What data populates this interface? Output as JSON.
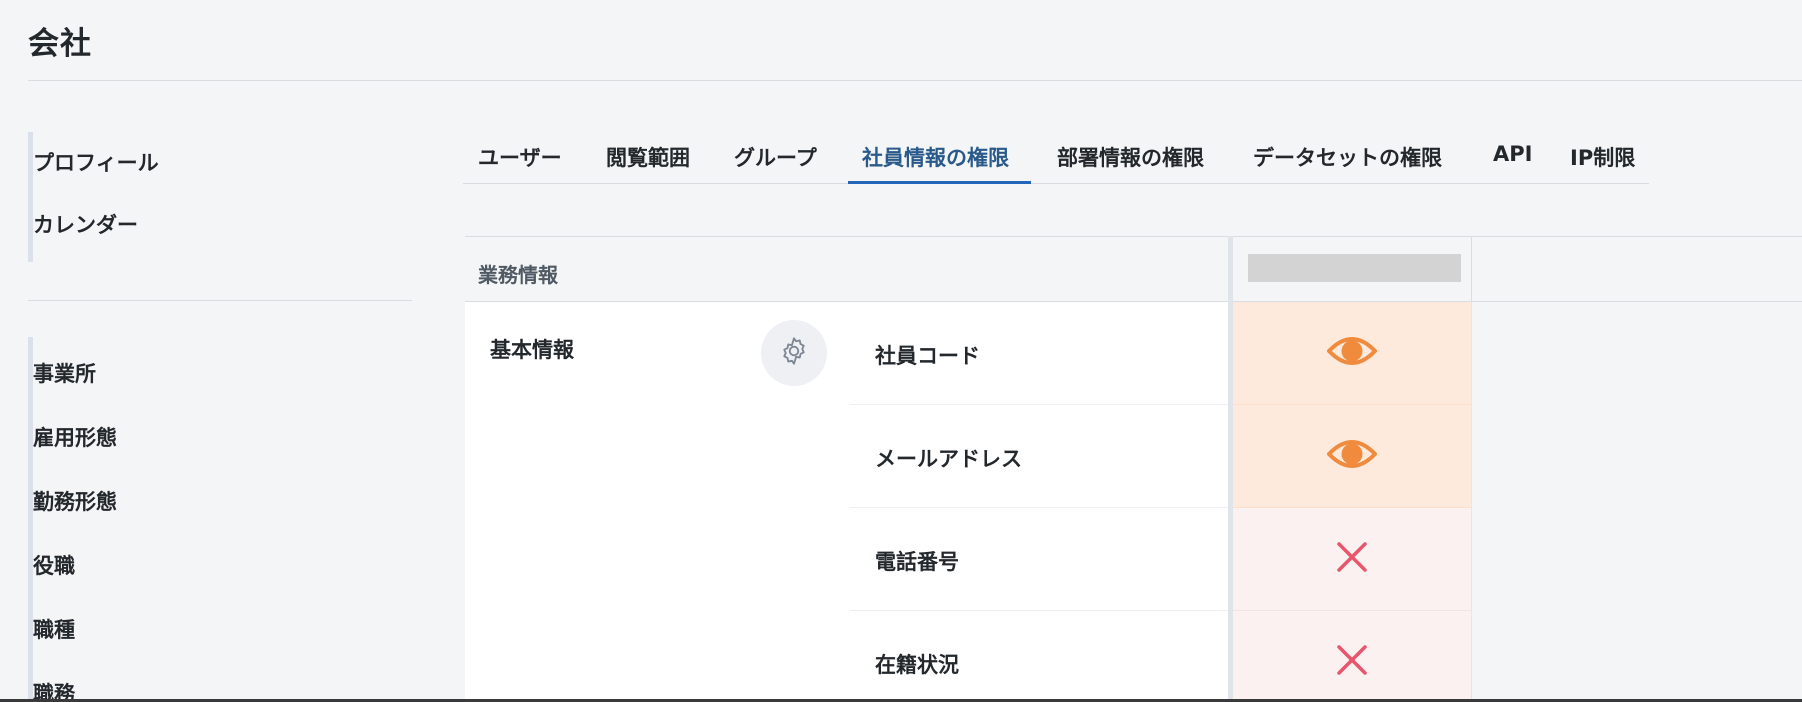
{
  "page": {
    "title": "会社"
  },
  "nav": {
    "group1": [
      {
        "label": "プロフィール"
      },
      {
        "label": "カレンダー"
      }
    ],
    "group2": [
      {
        "label": "事業所"
      },
      {
        "label": "雇用形態"
      },
      {
        "label": "勤務形態"
      },
      {
        "label": "役職"
      },
      {
        "label": "職種"
      },
      {
        "label": "職務"
      }
    ]
  },
  "tabs": [
    {
      "label": "ユーザー"
    },
    {
      "label": "閲覧範囲"
    },
    {
      "label": "グループ"
    },
    {
      "label": "社員情報の権限",
      "active": true
    },
    {
      "label": "部署情報の権限"
    },
    {
      "label": "データセットの権限"
    },
    {
      "label": "API"
    },
    {
      "label": "IP制限"
    }
  ],
  "table": {
    "section_label": "業務情報",
    "group_label": "基本情報",
    "settings_icon": "gear-icon",
    "rows": [
      {
        "field": "社員コード",
        "permission": "view",
        "icon": "eye-icon"
      },
      {
        "field": "メールアドレス",
        "permission": "view",
        "icon": "eye-icon"
      },
      {
        "field": "電話番号",
        "permission": "none",
        "icon": "close-icon"
      },
      {
        "field": "在籍状況",
        "permission": "none",
        "icon": "close-icon"
      }
    ]
  },
  "colors": {
    "accent": "#2166b8",
    "view_cell_bg": "#fdeadd",
    "view_icon": "#f08a3c",
    "deny_cell_bg": "#fcf1f1",
    "deny_icon": "#e8566c"
  }
}
